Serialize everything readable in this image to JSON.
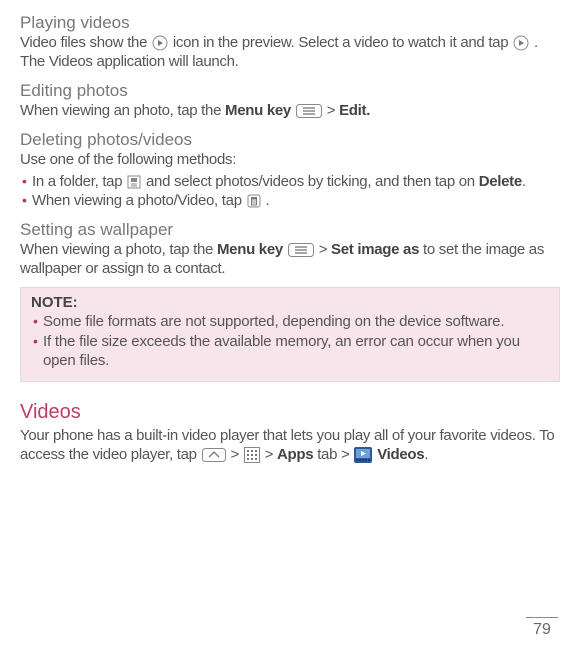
{
  "playing": {
    "heading": "Playing videos",
    "t1a": "Video files show the ",
    "t1b": " icon in the preview. Select a video to watch it and tap ",
    "t1c": ". The Videos application will launch."
  },
  "editing": {
    "heading": "Editing photos",
    "t1a": "When viewing an photo, tap the ",
    "menu_key": "Menu key",
    "t1b": " > ",
    "edit": "Edit."
  },
  "deleting": {
    "heading": "Deleting photos/videos",
    "t1": "Use one of the following methods:",
    "b1a": "In a folder, tap ",
    "b1b": " and select photos/videos by ticking, and then tap on ",
    "delete": "Delete",
    "b1c": ".",
    "b2a": "When viewing a photo/Video, tap ",
    "b2b": "."
  },
  "wallpaper": {
    "heading": "Setting as wallpaper",
    "t1a": "When viewing a photo, tap the ",
    "menu_key": "Menu key",
    "t1b": " > ",
    "set_image": "Set image as",
    "t1c": " to set the image as wallpaper or assign to a contact."
  },
  "note": {
    "title": "NOTE:",
    "b1": "Some file formats are not supported, depending on the device software.",
    "b2": "If the file size exceeds the available memory, an error can occur when you open files."
  },
  "videos": {
    "heading": "Videos",
    "t1a": "Your phone has a built-in video player that lets you play all of your favorite videos. To access the video player, tap ",
    "t1b": " > ",
    "t1c": " > ",
    "apps": "Apps",
    "t1d": " tab > ",
    "videos_label": " Videos",
    "t1e": "."
  },
  "page_number": "79"
}
